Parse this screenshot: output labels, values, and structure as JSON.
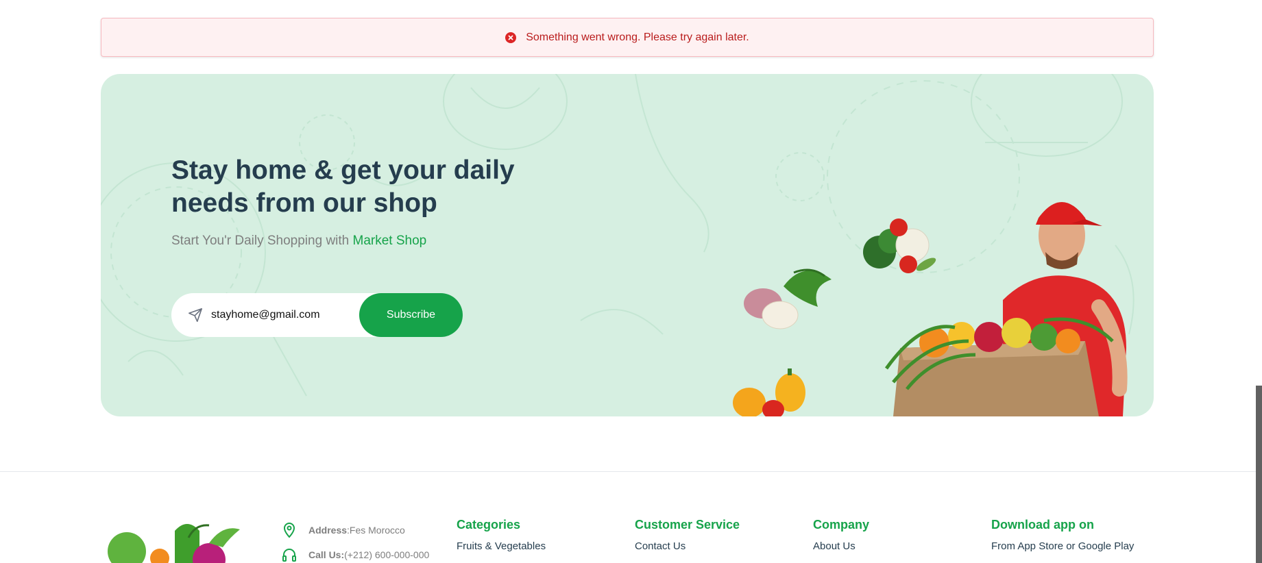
{
  "alert": {
    "icon": "error-circle-icon",
    "message": "Something went wrong. Please try again later."
  },
  "newsletter": {
    "title": "Stay home & get your daily needs from our shop",
    "subtitle_prefix": "Start You'r Daily Shopping with ",
    "subtitle_brand": "Market Shop",
    "email_value": "stayhome@gmail.com",
    "email_icon": "send-icon",
    "subscribe_label": "Subscribe"
  },
  "footer": {
    "contact": [
      {
        "icon": "location-pin-icon",
        "label": "Address",
        "sep": ": ",
        "value": "Fes Morocco"
      },
      {
        "icon": "headset-icon",
        "label": "Call Us:",
        "sep": " ",
        "value": "(+212) 600-000-000"
      }
    ],
    "columns": [
      {
        "title": "Categories",
        "first_link": "Fruits & Vegetables"
      },
      {
        "title": "Customer Service",
        "first_link": "Contact Us"
      },
      {
        "title": "Company",
        "first_link": "About Us"
      }
    ],
    "download": {
      "title": "Download app on",
      "text": "From App Store or Google Play"
    }
  },
  "colors": {
    "accent": "#16a34a",
    "banner_bg": "#d6efe1",
    "alert_bg": "#fef1f2",
    "alert_text": "#b91c1c",
    "heading": "#253d4e"
  }
}
